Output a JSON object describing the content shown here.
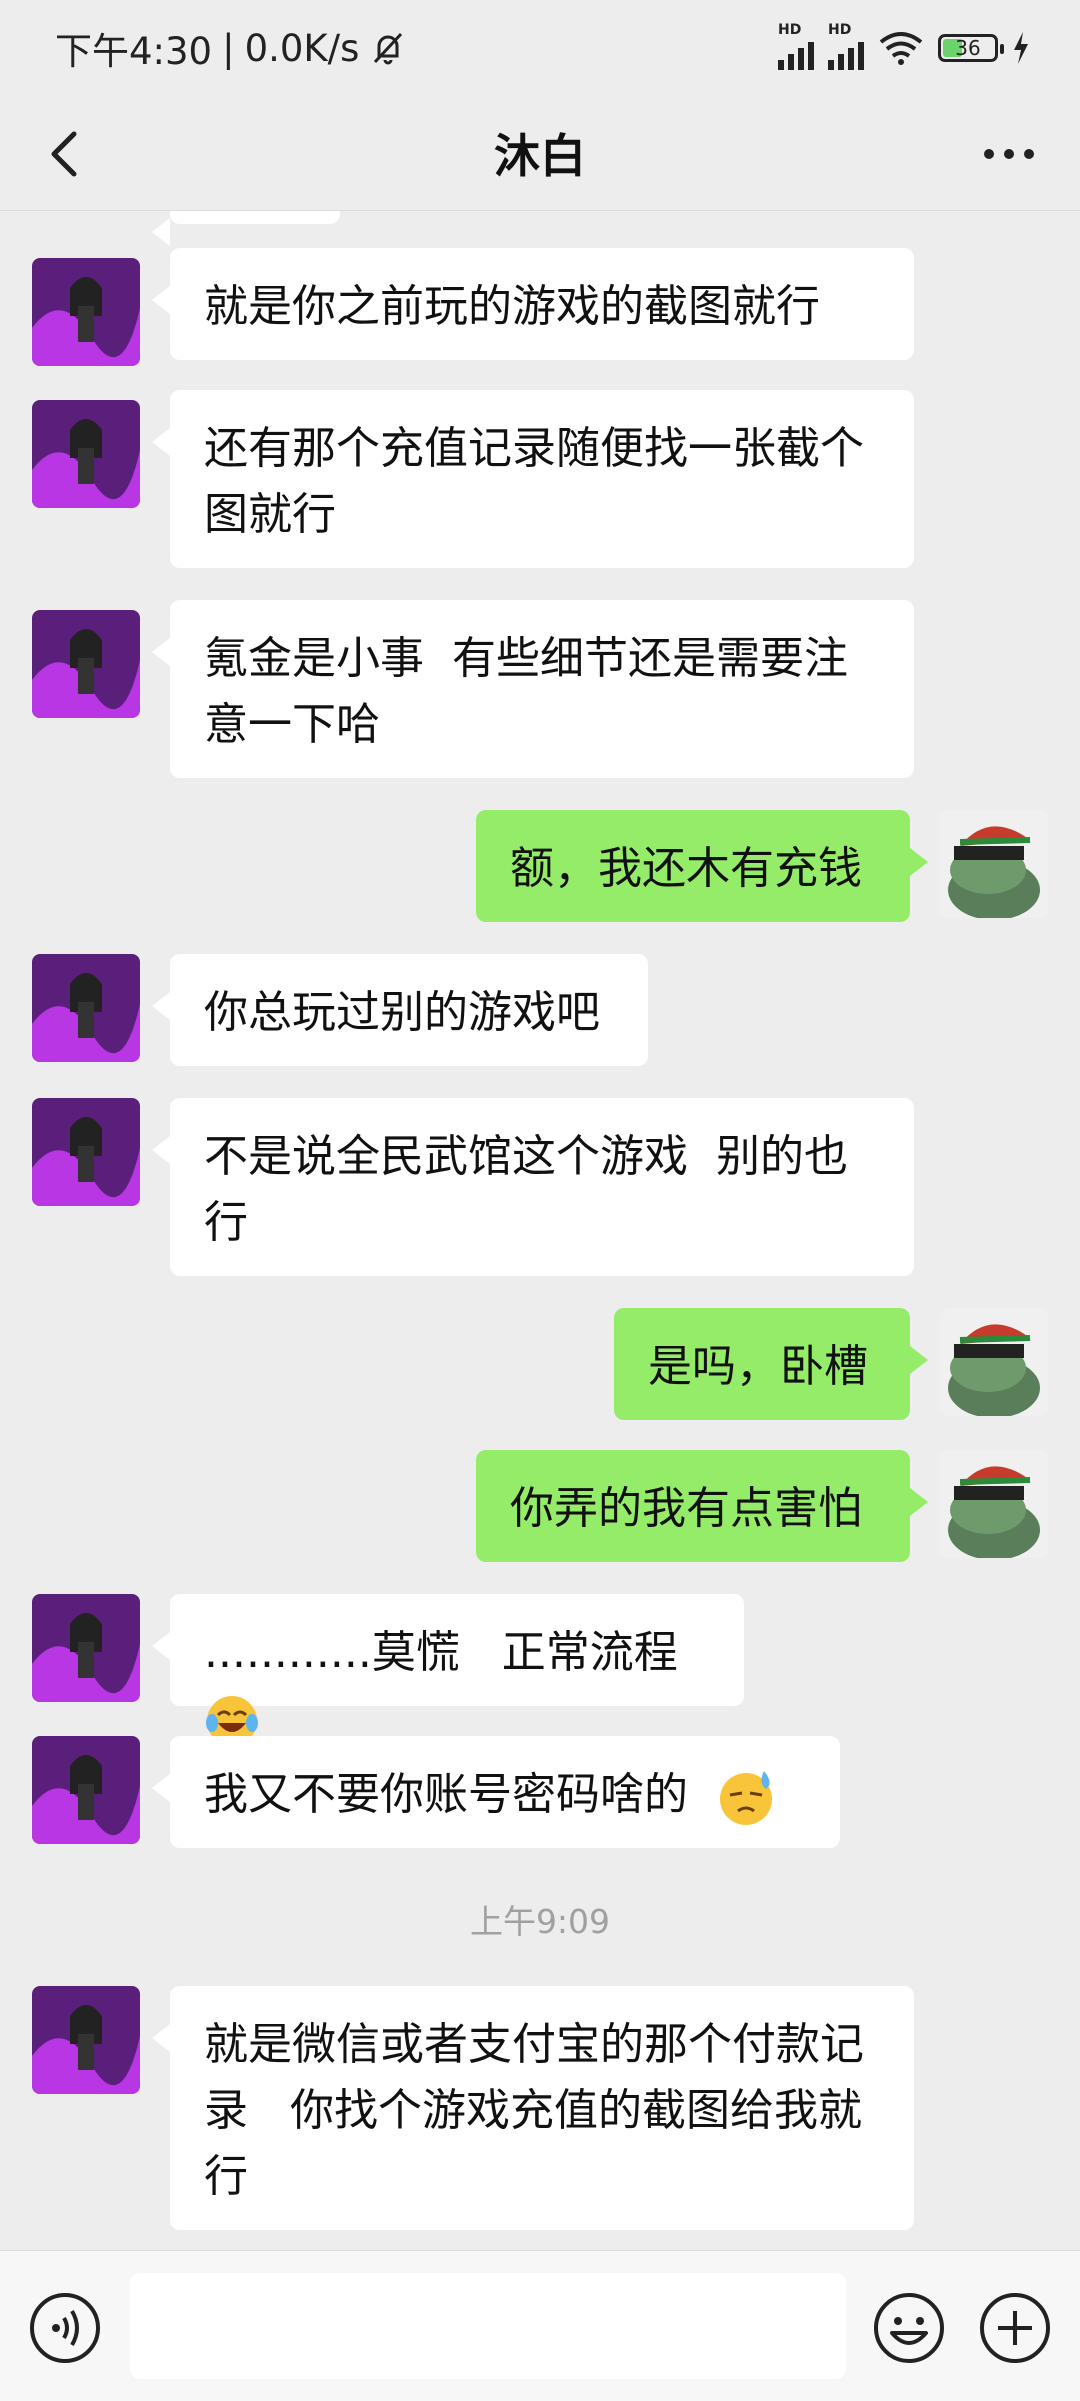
{
  "status_bar": {
    "time": "下午4:30",
    "separator": "|",
    "speed": "0.0K/s",
    "signal1_label": "HD",
    "signal2_label": "HD",
    "battery": "36"
  },
  "header": {
    "title": "沐白"
  },
  "messages": [
    {
      "from": "other",
      "text": "就是你之前玩的游戏的截图就行"
    },
    {
      "from": "other",
      "text": "还有那个充值记录随便找一张截个图就行"
    },
    {
      "from": "other",
      "text": "氪金是小事  有些细节还是需要注意一下哈"
    },
    {
      "from": "me",
      "text": "额，我还木有充钱"
    },
    {
      "from": "other",
      "text": "你总玩过别的游戏吧"
    },
    {
      "from": "other",
      "text": "不是说全民武馆这个游戏  别的也行"
    },
    {
      "from": "me",
      "text": "是吗，卧槽"
    },
    {
      "from": "me",
      "text": "你弄的我有点害怕"
    },
    {
      "from": "other",
      "text": "............莫慌   正常流程",
      "emoji": "crying-laughing"
    },
    {
      "from": "other",
      "text": "我又不要你账号密码啥的  ",
      "emoji": "sweat"
    },
    {
      "type": "time",
      "text": "上午9:09"
    },
    {
      "from": "other",
      "text": "就是微信或者支付宝的那个付款记录   你找个游戏充值的截图给我就行"
    }
  ],
  "input": {
    "placeholder": ""
  },
  "colors": {
    "background": "#ededed",
    "bubble_in": "#ffffff",
    "bubble_out": "#95ec69"
  }
}
